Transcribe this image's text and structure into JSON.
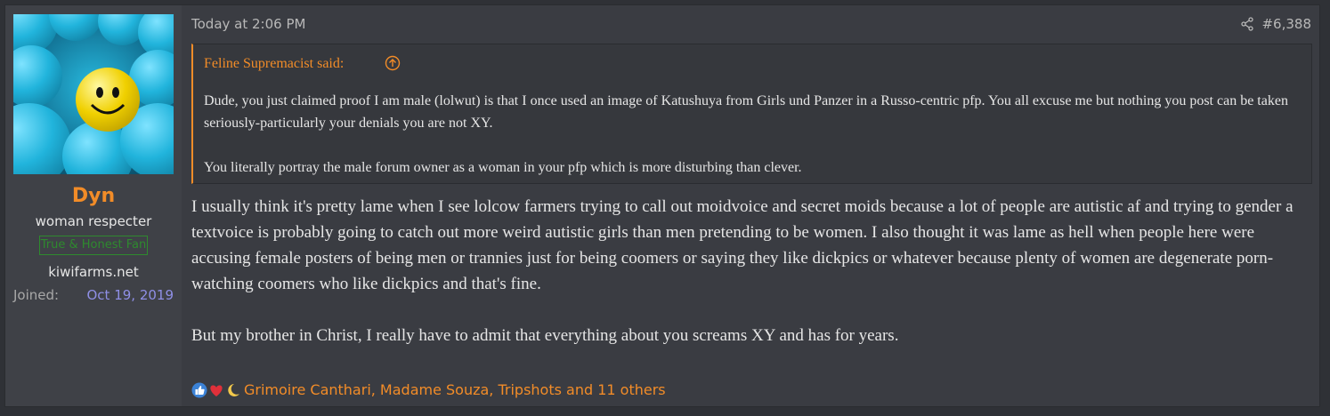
{
  "user": {
    "username": "Dyn",
    "title": "woman respecter",
    "banner": "True & Honest Fan",
    "site": "kiwifarms.net",
    "joined_label": "Joined:",
    "joined_value": "Oct 19, 2019",
    "avatar_icon": "avatar"
  },
  "post": {
    "timestamp": "Today at 2:06 PM",
    "number": "#6,388",
    "share_icon": "share-icon"
  },
  "quote": {
    "author": "Feline Supremacist said:",
    "arrow_icon": "arrow-up-circle-icon",
    "paragraphs": [
      "Dude, you just claimed proof I am male (lolwut) is that I once used an image of Katushuya from Girls und Panzer in a Russo-centric pfp. You all excuse me but nothing you post can be taken seriously-particularly your denials you are not XY.",
      "You literally portray the male forum owner as a woman in your pfp which is more disturbing than clever."
    ]
  },
  "message": {
    "paragraphs": [
      "I usually think it's pretty lame when I see lolcow farmers trying to call out moidvoice and secret moids because a lot of people are autistic af and trying to gender a textvoice is probably going to catch out more weird autistic girls than men pretending to be women. I also thought it was lame as hell when people here were accusing female posters of being men or trannies just for being coomers or saying they like dickpics or whatever because plenty of women are degenerate porn-watching coomers who like dickpics and that's fine.",
      "But my brother in Christ, I really have to admit that everything about you screams XY and has for years."
    ]
  },
  "reactions": {
    "icons": [
      "thumbs-up-icon",
      "heart-icon",
      "moon-icon"
    ],
    "text": "Grimoire Canthari, Madame Souza, Tripshots and 11 others"
  },
  "colors": {
    "accent": "#f28c28",
    "joined_date": "#8f8fe6",
    "banner": "#2e8a2e"
  }
}
